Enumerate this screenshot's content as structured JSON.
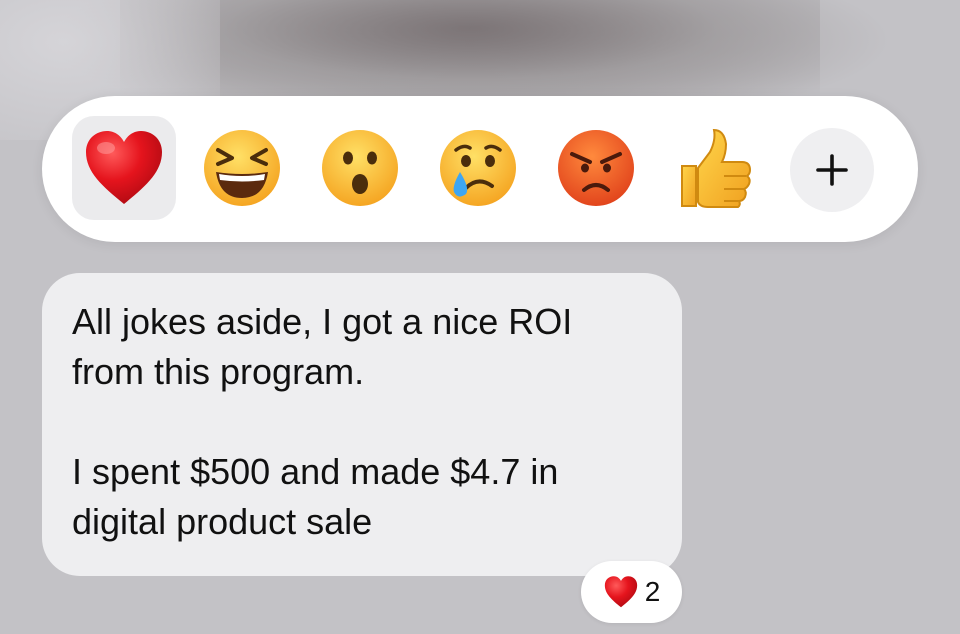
{
  "reaction_bar": {
    "reactions": [
      {
        "icon": "red-heart",
        "selected": true
      },
      {
        "icon": "laughing-face",
        "selected": false
      },
      {
        "icon": "surprised-face",
        "selected": false
      },
      {
        "icon": "crying-face",
        "selected": false
      },
      {
        "icon": "angry-face",
        "selected": false
      },
      {
        "icon": "thumbs-up",
        "selected": false
      }
    ],
    "more_icon": "plus-icon"
  },
  "message": {
    "text": "All jokes aside, I got a nice ROI\nfrom this program.\n\nI spent $500 and made $4.7 in\ndigital product sale",
    "reaction_summary": {
      "icon": "red-heart",
      "count": "2"
    }
  },
  "colors": {
    "bubble": "#eeeef0",
    "bar": "#ffffff",
    "heart": "#e5141d"
  }
}
